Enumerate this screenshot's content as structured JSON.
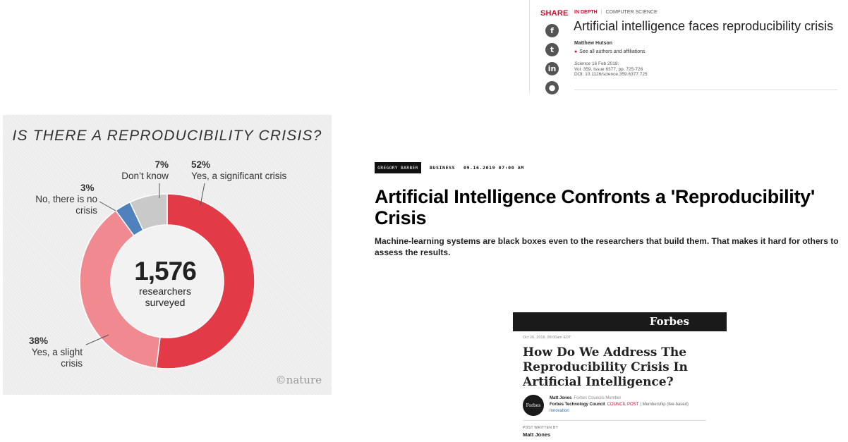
{
  "science": {
    "share_label": "SHARE",
    "social_icons": [
      "facebook-icon",
      "twitter-icon",
      "linkedin-icon",
      "reddit-icon"
    ],
    "category": "IN DEPTH",
    "subcategory": "COMPUTER SCIENCE",
    "title": "Artificial intelligence faces reproducibility crisis",
    "author": "Matthew Hutson",
    "affiliations_link": "See all authors and affiliations",
    "journal": "Science",
    "date": "16 Feb 2018:",
    "volume": "Vol. 359, Issue 6377, pp. 725-726",
    "doi": "DOI: 10.1126/science.359.6377.725",
    "accent_color": "#c8102e"
  },
  "nature": {
    "logo": "©nature",
    "center_value": "1,576",
    "center_label_line1": "researchers",
    "center_label_line2": "surveyed",
    "slice_labels": [
      {
        "pct": "52%",
        "text": "Yes, a significant crisis"
      },
      {
        "pct": "38%",
        "text": "Yes, a slight crisis"
      },
      {
        "pct": "3%",
        "text": "No, there is no crisis"
      },
      {
        "pct": "7%",
        "text": "Don’t know"
      }
    ]
  },
  "chart_data": {
    "type": "pie",
    "title": "IS THERE A REPRODUCIBILITY CRISIS?",
    "variant": "donut",
    "categories": [
      "Yes, a significant crisis",
      "Yes, a slight crisis",
      "No, there is no crisis",
      "Don’t know"
    ],
    "values": [
      52,
      38,
      3,
      7
    ],
    "colors": [
      "#e23b47",
      "#f08a90",
      "#4f82bd",
      "#c9c9c9"
    ],
    "center_text": "1,576 researchers surveyed"
  },
  "wired": {
    "author": "GREGORY BARBER",
    "section": "BUSINESS",
    "date": "09.16.2019 07:00 AM",
    "headline": "Artificial Intelligence Confronts a 'Reproducibility' Crisis",
    "dek": "Machine-learning systems are black boxes even to the researchers that build them. That makes it hard for others to assess the results."
  },
  "forbes": {
    "brand": "Forbes",
    "date": "Oct 26, 2018, 08:00am EDT",
    "headline": "How Do We Address The Reproducibility Crisis In Artificial Intelligence?",
    "avatar_text": "Forbes",
    "author": "Matt Jones",
    "author_role": "Forbes Councils Member",
    "council": "Forbes Technology Council",
    "council_post": "COUNCIL POST",
    "membership": "| Membership (fee-based)",
    "topic": "Innovation",
    "post_written_by": "POST WRITTEN BY",
    "post_author": "Matt Jones"
  }
}
